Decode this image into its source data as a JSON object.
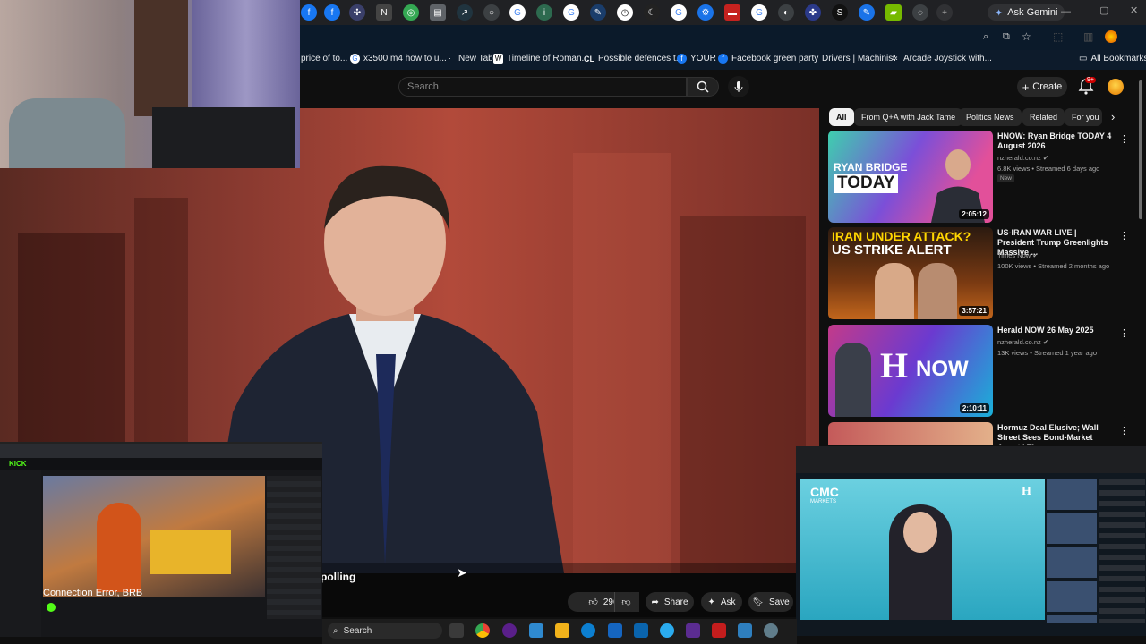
{
  "browser": {
    "ask_gemini_label": "Ask Gemini",
    "bookmarks": [
      {
        "label": "price of to...",
        "icon": "page-icon"
      },
      {
        "label": "x3500 m4 how to u...",
        "icon": "google-icon"
      },
      {
        "label": "New Tab",
        "icon": "newtab-icon"
      },
      {
        "label": "Timeline of Roman...",
        "icon": "wikipedia-icon"
      },
      {
        "label": "Possible defences t...",
        "icon": "cl-icon"
      },
      {
        "label": "YOUR",
        "icon": "facebook-icon"
      },
      {
        "label": "Facebook green party",
        "icon": "facebook-icon"
      },
      {
        "label": "Drivers | Machinist",
        "icon": "page-icon"
      },
      {
        "label": "Arcade Joystick with...",
        "icon": "aliexpress-icon"
      }
    ],
    "all_bookmarks_label": "All Bookmarks"
  },
  "header": {
    "search_placeholder": "Search",
    "create_label": "Create",
    "notification_badge": "9+"
  },
  "player": {
    "caption": "polling",
    "like_count": "296",
    "share_label": "Share",
    "ask_label": "Ask",
    "save_label": "Save"
  },
  "chips": [
    "All",
    "From Q+A with Jack Tame",
    "Politics News",
    "Related",
    "For you"
  ],
  "recommendations": [
    {
      "title": "HNOW: Ryan Bridge TODAY 4 August 2026",
      "channel": "nzherald.co.nz",
      "meta": "6.8K views • Streamed 6 days ago",
      "tag": "New",
      "duration": "2:05:12",
      "thumb_text": [
        "RYAN BRIDGE",
        "TODAY"
      ]
    },
    {
      "title": "US-IRAN WAR LIVE | President Trump Greenlights Massive ...",
      "channel": "Times Now",
      "meta": "100K views • Streamed 2 months ago",
      "duration": "3:57:21",
      "thumb_text": [
        "IRAN UNDER ATTACK?",
        "US STRIKE ALERT"
      ]
    },
    {
      "title": "Herald NOW 26 May 2025",
      "channel": "nzherald.co.nz",
      "meta": "13K views • Streamed 1 year ago",
      "duration": "2:10:11",
      "thumb_text": [
        "H",
        "NOW"
      ]
    },
    {
      "title": "Hormuz Deal Elusive; Wall Street Sees Bond-Market Angst | The ..."
    }
  ],
  "overlays": {
    "stream_status": "Connection Error, BRB",
    "news_logo": "CMC",
    "news_logo_sub": "MARKETS"
  },
  "taskbar": {
    "search_label": "Search"
  },
  "colors": {
    "youtube_red": "#cc0000",
    "background": "#0f0f0f",
    "chip_active": "#f1f1f1"
  }
}
